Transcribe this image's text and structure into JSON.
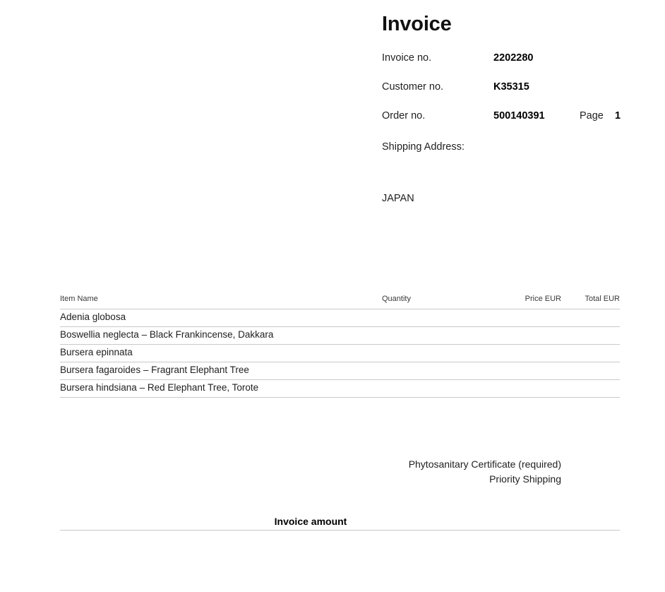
{
  "document": {
    "title": "Invoice"
  },
  "meta": {
    "rows": [
      {
        "label": "Invoice no.",
        "value": "2202280"
      },
      {
        "label": "Customer no.",
        "value": "K35315"
      },
      {
        "label": "Order no.",
        "value": "500140391"
      }
    ],
    "page_label": "Page",
    "page_value": "1"
  },
  "shipping": {
    "label": "Shipping Address:",
    "address": "JAPAN"
  },
  "table": {
    "headers": {
      "item_name": "Item Name",
      "quantity": "Quantity",
      "price": "Price EUR",
      "total": "Total EUR"
    },
    "rows": [
      {
        "name": "Adenia globosa",
        "quantity": "",
        "price": "",
        "total": ""
      },
      {
        "name": "Boswellia neglecta – Black Frankincense, Dakkara",
        "quantity": "",
        "price": "",
        "total": ""
      },
      {
        "name": "Bursera epinnata",
        "quantity": "",
        "price": "",
        "total": ""
      },
      {
        "name": "Bursera fagaroides – Fragrant Elephant Tree",
        "quantity": "",
        "price": "",
        "total": ""
      },
      {
        "name": "Bursera hindsiana – Red Elephant Tree, Torote",
        "quantity": "",
        "price": "",
        "total": ""
      }
    ]
  },
  "extras": [
    "Phytosanitary Certificate (required)",
    "Priority Shipping"
  ],
  "totals": {
    "label": "Invoice amount",
    "value": ""
  },
  "colors": {
    "text": "#1f1f1f",
    "heading": "#111111",
    "rule": "#c9c9c9",
    "background": "#ffffff"
  }
}
